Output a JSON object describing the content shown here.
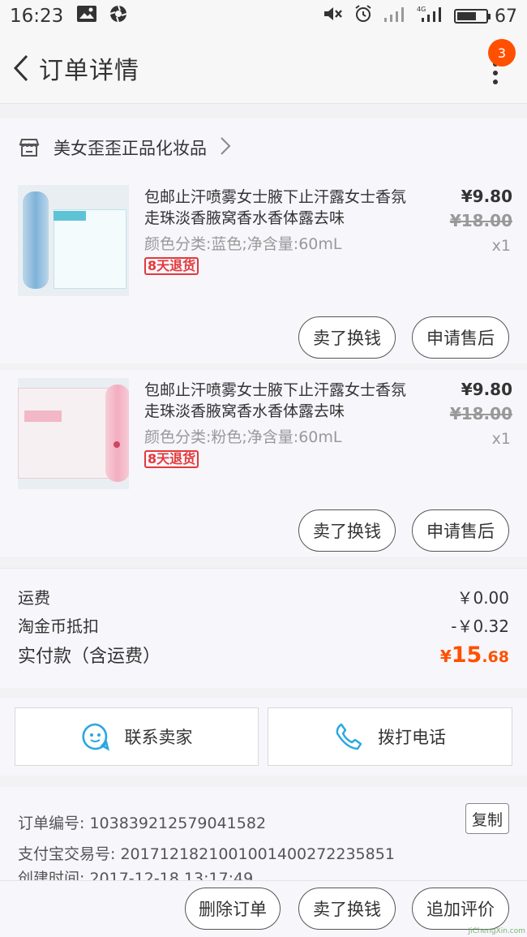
{
  "status_bar": {
    "time": "16:23",
    "battery": "67",
    "network": "4G",
    "battery_level_percent": 67
  },
  "header": {
    "title": "订单详情",
    "badge_count": "3"
  },
  "shop": {
    "name": "美女歪歪正品化妆品"
  },
  "items": [
    {
      "title": "包邮止汗喷雾女士腋下止汗露女士香氛走珠淡香腋窝香水香体露去味",
      "spec": "颜色分类:蓝色;净含量:60mL",
      "tag": "8天退货",
      "price": "¥9.80",
      "original_price": "¥18.00",
      "quantity": "x1",
      "actions": [
        "卖了换钱",
        "申请售后"
      ],
      "thumb_color": "#7fb3d9"
    },
    {
      "title": "包邮止汗喷雾女士腋下止汗露女士香氛走珠淡香腋窝香水香体露去味",
      "spec": "颜色分类:粉色;净含量:60mL",
      "tag": "8天退货",
      "price": "¥9.80",
      "original_price": "¥18.00",
      "quantity": "x1",
      "actions": [
        "卖了换钱",
        "申请售后"
      ],
      "thumb_color": "#f3aec0"
    }
  ],
  "summary": {
    "shipping_label": "运费",
    "shipping_value": "￥0.00",
    "coin_label": "淘金币抵扣",
    "coin_value": "-￥0.32",
    "total_label": "实付款（含运费）",
    "total_currency": "¥",
    "total_int": "15",
    "total_dec": ".68"
  },
  "contact": {
    "seller_label": "联系卖家",
    "phone_label": "拨打电话"
  },
  "order_info": {
    "order_no": "订单编号: 103839212579041582",
    "alipay_no": "支付宝交易号: 2017121821001001400272235851",
    "created": "创建时间: 2017-12-18 13:17:49",
    "copy_label": "复制"
  },
  "bottom_bar": {
    "delete_label": "删除订单",
    "sell_label": "卖了换钱",
    "review_label": "追加评价",
    "watermark": "JiChengXin.com"
  },
  "colors": {
    "accent": "#ff5000",
    "tag_red": "#e4393c",
    "seller_icon": "#28a8e0"
  }
}
